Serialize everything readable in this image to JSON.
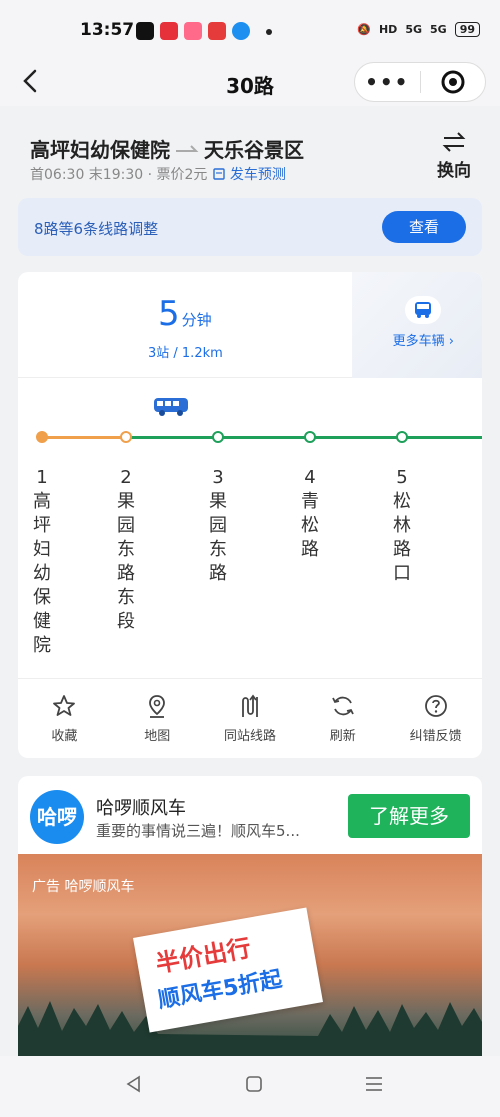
{
  "status_bar": {
    "time": "13:57",
    "network": "5G",
    "hd": "HD",
    "battery": "99"
  },
  "nav": {
    "title": "30路",
    "more": "•••"
  },
  "route": {
    "from": "高坪妇幼保健院",
    "to": "天乐谷景区",
    "hours": "首06:30 末19:30 · 票价2元",
    "schedule_link": "发车预测",
    "swap_label": "换向"
  },
  "notice": {
    "text": "8路等6条线路调整",
    "button": "查看"
  },
  "eta": {
    "minutes": "5",
    "unit": "分钟",
    "detail": "3站 / 1.2km",
    "more_vehicles": "更多车辆 ›"
  },
  "stops": [
    {
      "num": "1",
      "name": "高坪妇幼保健院"
    },
    {
      "num": "2",
      "name": "果园东路东段"
    },
    {
      "num": "3",
      "name": "果园东路"
    },
    {
      "num": "4",
      "name": "青松路"
    },
    {
      "num": "5",
      "name": "松林路口"
    }
  ],
  "actions": [
    {
      "label": "收藏",
      "icon": "star-icon"
    },
    {
      "label": "地图",
      "icon": "map-pin-icon"
    },
    {
      "label": "同站线路",
      "icon": "route-icon"
    },
    {
      "label": "刷新",
      "icon": "refresh-icon"
    },
    {
      "label": "纠错反馈",
      "icon": "help-icon"
    }
  ],
  "ad": {
    "logo_text": "哈啰",
    "title": "哈啰顺风车",
    "desc": "重要的事情说三遍！顺风车5...",
    "button": "了解更多",
    "banner_brand": "广告 哈啰顺风车",
    "promo_line1": "半价出行",
    "promo_line2": "顺风车5折起"
  },
  "colors": {
    "accent": "#1c6ee6",
    "passed": "#f0a04a",
    "upcoming": "#1fa05a"
  }
}
